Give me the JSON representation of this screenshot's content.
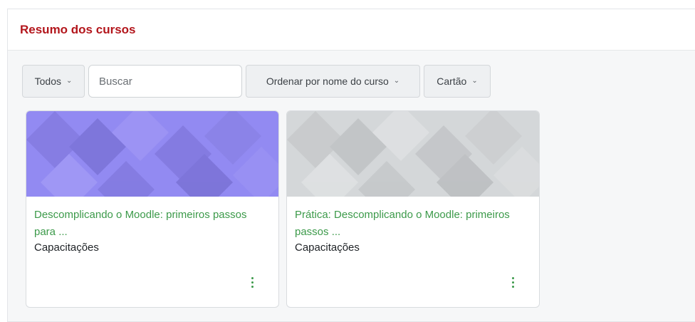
{
  "block": {
    "title": "Resumo dos cursos"
  },
  "toolbar": {
    "filter_label": "Todos",
    "search_placeholder": "Buscar",
    "sort_label": "Ordenar por nome do curso",
    "view_label": "Cartão"
  },
  "courses": [
    {
      "name": "Descomplicando o Moodle: primeiros passos para ...",
      "category": "Capacitações",
      "pattern_color": "#8e86f0"
    },
    {
      "name": "Prática: Descomplicando o Moodle: primeiros passos ...",
      "category": "Capacitações",
      "pattern_color": "#c9ccce"
    }
  ],
  "colors": {
    "title": "#b3161c",
    "link": "#3c9a4a"
  }
}
